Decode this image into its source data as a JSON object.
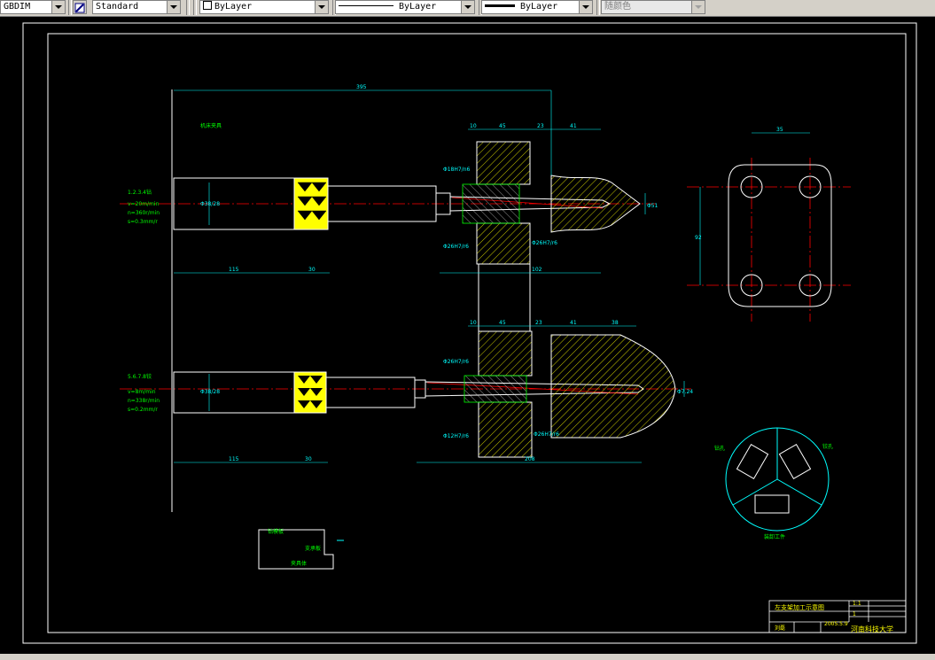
{
  "toolbar": {
    "dimstyle_value": "GBDIM",
    "textstyle_value": "Standard",
    "layer_value": "ByLayer",
    "linetype_value": "ByLayer",
    "lineweight_value": "ByLayer",
    "plotstyle_value": "随颜色"
  },
  "colors": {
    "background": "#000000",
    "border": "#ffffff",
    "dimension": "#00ffff",
    "centerline": "#ff0000",
    "hatch": "#ffff00",
    "annotation": "#00ff00",
    "part_outline": "#ffffff"
  },
  "drawing": {
    "dims": {
      "top_overall": "395",
      "top_seg_10": "10",
      "top_seg_45": "45",
      "top_seg_23": "23",
      "top_seg_41": "41",
      "bottom_seg_115": "115",
      "bottom_seg_30": "30",
      "bottom_seg_102": "102",
      "lower_seg_10": "10",
      "lower_seg_45": "45",
      "lower_seg_23": "23",
      "lower_seg_41": "41",
      "lower_seg_38": "38",
      "lower_bottom_115": "115",
      "lower_bottom_30": "30",
      "lower_bottom_208": "208",
      "view_width_35": "35",
      "view_height_92": "92",
      "dia_upper": "Φ51",
      "dia_lower": "Φ7.24"
    },
    "annotations": {
      "leader_top": "机床夹具",
      "station_upper": "1.2.3.4钻",
      "upper_v": "v=20m/min",
      "upper_n": "n=360r/min",
      "upper_s": "s=0.3mm/r",
      "station_lower": "5.6.7.8铰",
      "lower_v": "v=8m/min",
      "lower_n": "n=338r/min",
      "lower_s": "s=0.2mm/r",
      "fit_upper_1": "Φ18H7/n6",
      "fit_upper_2": "Φ26H7/r6",
      "fit_upper_3": "Φ26H7/r6",
      "fit_lower_1": "Φ26H7/r6",
      "fit_lower_2": "Φ12H7/r6",
      "fit_lower_3": "Φ26H7/r6",
      "spindle_upper": "Φ38/28",
      "spindle_lower": "Φ38/28",
      "rotary_left": "钻孔",
      "rotary_right": "铰孔",
      "rotary_bottom": "装卸工件",
      "block_top": "钻模板",
      "block_side": "支承板",
      "block_bottom": "夹具体"
    },
    "title_block": {
      "drawing_name": "左支架加工示意图",
      "scale": "1:1",
      "sheet": "1",
      "drawn_by": "刘磊",
      "date": "2005.5.9",
      "school": "河南科技大学"
    }
  }
}
